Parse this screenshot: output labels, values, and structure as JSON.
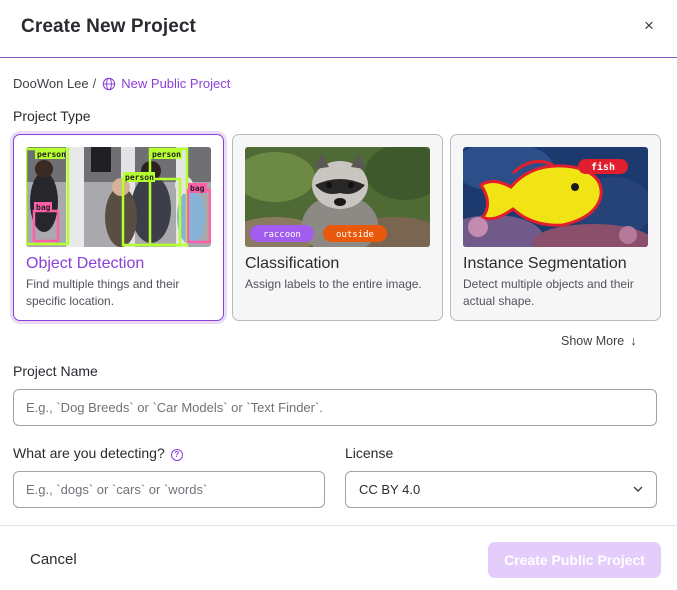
{
  "modal": {
    "title": "Create New Project",
    "close_glyph": "×"
  },
  "breadcrumb": {
    "owner": "DooWon Lee",
    "separator": "/",
    "project": "New Public Project",
    "project_icon": "globe-icon"
  },
  "project_type": {
    "label": "Project Type",
    "cards": [
      {
        "name": "Object Detection",
        "description": "Find multiple things and their specific location.",
        "selected": true,
        "tags": [
          "person",
          "person",
          "person",
          "bag",
          "bag"
        ]
      },
      {
        "name": "Classification",
        "description": "Assign labels to the entire image.",
        "selected": false,
        "tags": [
          "raccoon",
          "outside"
        ]
      },
      {
        "name": "Instance Segmentation",
        "description": "Detect multiple objects and their actual shape.",
        "selected": false,
        "tags": [
          "fish"
        ]
      }
    ],
    "show_more": "Show More",
    "show_more_glyph": "↓"
  },
  "project_name": {
    "label": "Project Name",
    "placeholder": "E.g., `Dog Breeds` or `Car Models` or `Text Finder`.",
    "value": ""
  },
  "detecting": {
    "label": "What are you detecting?",
    "help_glyph": "?",
    "placeholder": "E.g., `dogs` or `cars` or `words`",
    "value": ""
  },
  "license": {
    "label": "License",
    "selected": "CC BY 4.0"
  },
  "footer": {
    "cancel_label": "Cancel",
    "create_label": "Create Public Project"
  },
  "colors": {
    "accent": "#8b3fd9",
    "create_disabled": "#e4ccfb",
    "header_divider": "#8a5bb8",
    "tag_purple": "#a25cf0",
    "tag_orange": "#e8590c",
    "tag_red": "#e01e2d",
    "box_green": "#b5ff2e",
    "box_pink": "#ff5fa8"
  }
}
